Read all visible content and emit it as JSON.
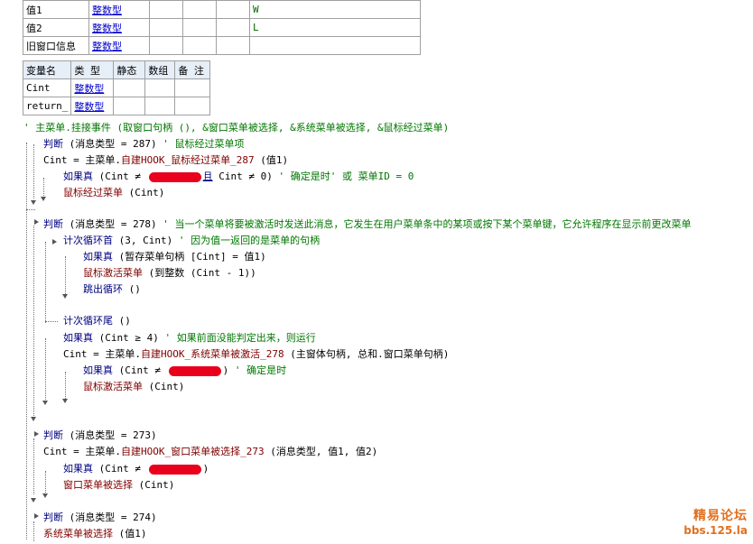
{
  "table1": {
    "rows": [
      {
        "name": "值1",
        "type": "整数型",
        "note": "W"
      },
      {
        "name": "值2",
        "type": "整数型",
        "note": "L"
      },
      {
        "name": "旧窗口信息",
        "type": "整数型",
        "note": ""
      }
    ]
  },
  "table2": {
    "headers": [
      "变量名",
      "类 型",
      "静态",
      "数组",
      "备 注"
    ],
    "rows": [
      {
        "name": "Cint",
        "type": "整数型"
      },
      {
        "name": "return_",
        "type": "整数型"
      }
    ]
  },
  "code": {
    "l1": "' 主菜单.挂接事件 (取窗口句柄 (), &窗口菜单被选择, &系统菜单被选择, &鼠标经过菜单)",
    "l2_kw": "判断",
    "l2_rest": " (消息类型 = 287)",
    "l2_cm": " ' 鼠标经过菜单项",
    "l3": "Cint = 主菜单.",
    "l3_fn": "自建HOOK_鼠标经过菜单_287",
    "l3_rest": " (值1)",
    "l4_kw": "如果真",
    "l4_a": " (Cint ≠ ",
    "l4_b": "且",
    "l4_c": " Cint ≠ 0)",
    "l4_cm": " ' 确定是时' 或 菜单ID = 0",
    "l5_fn": "鼠标经过菜单",
    "l5_rest": " (Cint)",
    "l6_kw": "判断",
    "l6_rest": " (消息类型 = 278)",
    "l6_cm": " ' 当一个菜单将要被激活时发送此消息，它发生在用户菜单条中的某项或按下某个菜单键，它允许程序在显示前更改菜单",
    "l7_kw": "计次循环首",
    "l7_rest": " (3, Cint)",
    "l7_cm": " ' 因为值一返回的是菜单的句柄",
    "l8_kw": "如果真",
    "l8_rest": " (暂存菜单句柄 [Cint] = 值1)",
    "l9_fn": "鼠标激活菜单",
    "l9_rest": " (到整数 (Cint - 1))",
    "l10_kw": "跳出循环",
    "l10_rest": " ()",
    "l11_kw": "计次循环尾",
    "l11_rest": " ()",
    "l12_kw": "如果真",
    "l12_rest": " (Cint ≥ 4)",
    "l12_cm": " ' 如果前面没能判定出来，则运行",
    "l13": "Cint = 主菜单.",
    "l13_fn": "自建HOOK_系统菜单被激活_278",
    "l13_rest": " (主窗体句柄, 总和.窗口菜单句柄)",
    "l14_kw": "如果真",
    "l14_a": " (Cint ≠ ",
    "l14_b": ")",
    "l14_cm": " ' 确定是时",
    "l15_fn": "鼠标激活菜单",
    "l15_rest": " (Cint)",
    "l16_kw": "判断",
    "l16_rest": " (消息类型 = 273)",
    "l17": "Cint = 主菜单.",
    "l17_fn": "自建HOOK_窗口菜单被选择_273",
    "l17_rest": " (消息类型, 值1, 值2)",
    "l18_kw": "如果真",
    "l18_a": " (Cint ≠ ",
    "l18_b": ")",
    "l19_fn": "窗口菜单被选择",
    "l19_rest": " (Cint)",
    "l20_kw": "判断",
    "l20_rest": " (消息类型 = 274)",
    "l21_fn": "系统菜单被选择",
    "l21_rest": " (值1)"
  },
  "watermark": {
    "line1": "精易论坛",
    "line2": "bbs.125.la"
  },
  "colors": {
    "keyword": "#000080",
    "function": "#800000",
    "comment": "#007700",
    "redaction": "#e8001c",
    "watermark": "#e07020"
  }
}
